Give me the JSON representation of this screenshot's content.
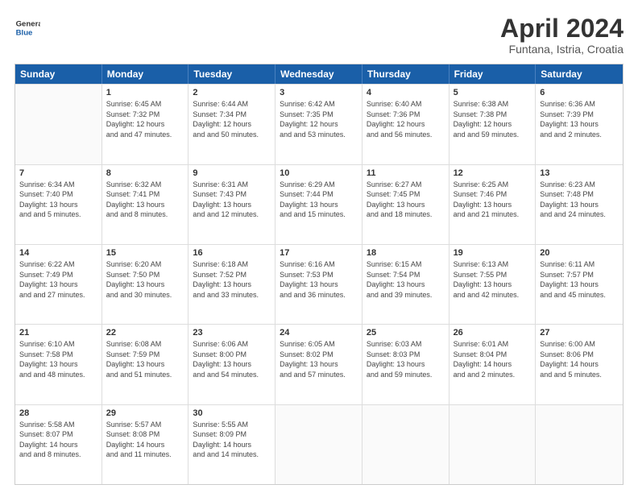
{
  "logo": {
    "line1": "General",
    "line2": "Blue"
  },
  "title": "April 2024",
  "subtitle": "Funtana, Istria, Croatia",
  "days": [
    "Sunday",
    "Monday",
    "Tuesday",
    "Wednesday",
    "Thursday",
    "Friday",
    "Saturday"
  ],
  "weeks": [
    [
      {
        "day": "",
        "sunrise": "",
        "sunset": "",
        "daylight": "",
        "empty": true
      },
      {
        "day": "1",
        "sunrise": "Sunrise: 6:45 AM",
        "sunset": "Sunset: 7:32 PM",
        "daylight": "Daylight: 12 hours and 47 minutes."
      },
      {
        "day": "2",
        "sunrise": "Sunrise: 6:44 AM",
        "sunset": "Sunset: 7:34 PM",
        "daylight": "Daylight: 12 hours and 50 minutes."
      },
      {
        "day": "3",
        "sunrise": "Sunrise: 6:42 AM",
        "sunset": "Sunset: 7:35 PM",
        "daylight": "Daylight: 12 hours and 53 minutes."
      },
      {
        "day": "4",
        "sunrise": "Sunrise: 6:40 AM",
        "sunset": "Sunset: 7:36 PM",
        "daylight": "Daylight: 12 hours and 56 minutes."
      },
      {
        "day": "5",
        "sunrise": "Sunrise: 6:38 AM",
        "sunset": "Sunset: 7:38 PM",
        "daylight": "Daylight: 12 hours and 59 minutes."
      },
      {
        "day": "6",
        "sunrise": "Sunrise: 6:36 AM",
        "sunset": "Sunset: 7:39 PM",
        "daylight": "Daylight: 13 hours and 2 minutes."
      }
    ],
    [
      {
        "day": "7",
        "sunrise": "Sunrise: 6:34 AM",
        "sunset": "Sunset: 7:40 PM",
        "daylight": "Daylight: 13 hours and 5 minutes."
      },
      {
        "day": "8",
        "sunrise": "Sunrise: 6:32 AM",
        "sunset": "Sunset: 7:41 PM",
        "daylight": "Daylight: 13 hours and 8 minutes."
      },
      {
        "day": "9",
        "sunrise": "Sunrise: 6:31 AM",
        "sunset": "Sunset: 7:43 PM",
        "daylight": "Daylight: 13 hours and 12 minutes."
      },
      {
        "day": "10",
        "sunrise": "Sunrise: 6:29 AM",
        "sunset": "Sunset: 7:44 PM",
        "daylight": "Daylight: 13 hours and 15 minutes."
      },
      {
        "day": "11",
        "sunrise": "Sunrise: 6:27 AM",
        "sunset": "Sunset: 7:45 PM",
        "daylight": "Daylight: 13 hours and 18 minutes."
      },
      {
        "day": "12",
        "sunrise": "Sunrise: 6:25 AM",
        "sunset": "Sunset: 7:46 PM",
        "daylight": "Daylight: 13 hours and 21 minutes."
      },
      {
        "day": "13",
        "sunrise": "Sunrise: 6:23 AM",
        "sunset": "Sunset: 7:48 PM",
        "daylight": "Daylight: 13 hours and 24 minutes."
      }
    ],
    [
      {
        "day": "14",
        "sunrise": "Sunrise: 6:22 AM",
        "sunset": "Sunset: 7:49 PM",
        "daylight": "Daylight: 13 hours and 27 minutes."
      },
      {
        "day": "15",
        "sunrise": "Sunrise: 6:20 AM",
        "sunset": "Sunset: 7:50 PM",
        "daylight": "Daylight: 13 hours and 30 minutes."
      },
      {
        "day": "16",
        "sunrise": "Sunrise: 6:18 AM",
        "sunset": "Sunset: 7:52 PM",
        "daylight": "Daylight: 13 hours and 33 minutes."
      },
      {
        "day": "17",
        "sunrise": "Sunrise: 6:16 AM",
        "sunset": "Sunset: 7:53 PM",
        "daylight": "Daylight: 13 hours and 36 minutes."
      },
      {
        "day": "18",
        "sunrise": "Sunrise: 6:15 AM",
        "sunset": "Sunset: 7:54 PM",
        "daylight": "Daylight: 13 hours and 39 minutes."
      },
      {
        "day": "19",
        "sunrise": "Sunrise: 6:13 AM",
        "sunset": "Sunset: 7:55 PM",
        "daylight": "Daylight: 13 hours and 42 minutes."
      },
      {
        "day": "20",
        "sunrise": "Sunrise: 6:11 AM",
        "sunset": "Sunset: 7:57 PM",
        "daylight": "Daylight: 13 hours and 45 minutes."
      }
    ],
    [
      {
        "day": "21",
        "sunrise": "Sunrise: 6:10 AM",
        "sunset": "Sunset: 7:58 PM",
        "daylight": "Daylight: 13 hours and 48 minutes."
      },
      {
        "day": "22",
        "sunrise": "Sunrise: 6:08 AM",
        "sunset": "Sunset: 7:59 PM",
        "daylight": "Daylight: 13 hours and 51 minutes."
      },
      {
        "day": "23",
        "sunrise": "Sunrise: 6:06 AM",
        "sunset": "Sunset: 8:00 PM",
        "daylight": "Daylight: 13 hours and 54 minutes."
      },
      {
        "day": "24",
        "sunrise": "Sunrise: 6:05 AM",
        "sunset": "Sunset: 8:02 PM",
        "daylight": "Daylight: 13 hours and 57 minutes."
      },
      {
        "day": "25",
        "sunrise": "Sunrise: 6:03 AM",
        "sunset": "Sunset: 8:03 PM",
        "daylight": "Daylight: 13 hours and 59 minutes."
      },
      {
        "day": "26",
        "sunrise": "Sunrise: 6:01 AM",
        "sunset": "Sunset: 8:04 PM",
        "daylight": "Daylight: 14 hours and 2 minutes."
      },
      {
        "day": "27",
        "sunrise": "Sunrise: 6:00 AM",
        "sunset": "Sunset: 8:06 PM",
        "daylight": "Daylight: 14 hours and 5 minutes."
      }
    ],
    [
      {
        "day": "28",
        "sunrise": "Sunrise: 5:58 AM",
        "sunset": "Sunset: 8:07 PM",
        "daylight": "Daylight: 14 hours and 8 minutes."
      },
      {
        "day": "29",
        "sunrise": "Sunrise: 5:57 AM",
        "sunset": "Sunset: 8:08 PM",
        "daylight": "Daylight: 14 hours and 11 minutes."
      },
      {
        "day": "30",
        "sunrise": "Sunrise: 5:55 AM",
        "sunset": "Sunset: 8:09 PM",
        "daylight": "Daylight: 14 hours and 14 minutes."
      },
      {
        "day": "",
        "sunrise": "",
        "sunset": "",
        "daylight": "",
        "empty": true
      },
      {
        "day": "",
        "sunrise": "",
        "sunset": "",
        "daylight": "",
        "empty": true
      },
      {
        "day": "",
        "sunrise": "",
        "sunset": "",
        "daylight": "",
        "empty": true
      },
      {
        "day": "",
        "sunrise": "",
        "sunset": "",
        "daylight": "",
        "empty": true
      }
    ]
  ]
}
